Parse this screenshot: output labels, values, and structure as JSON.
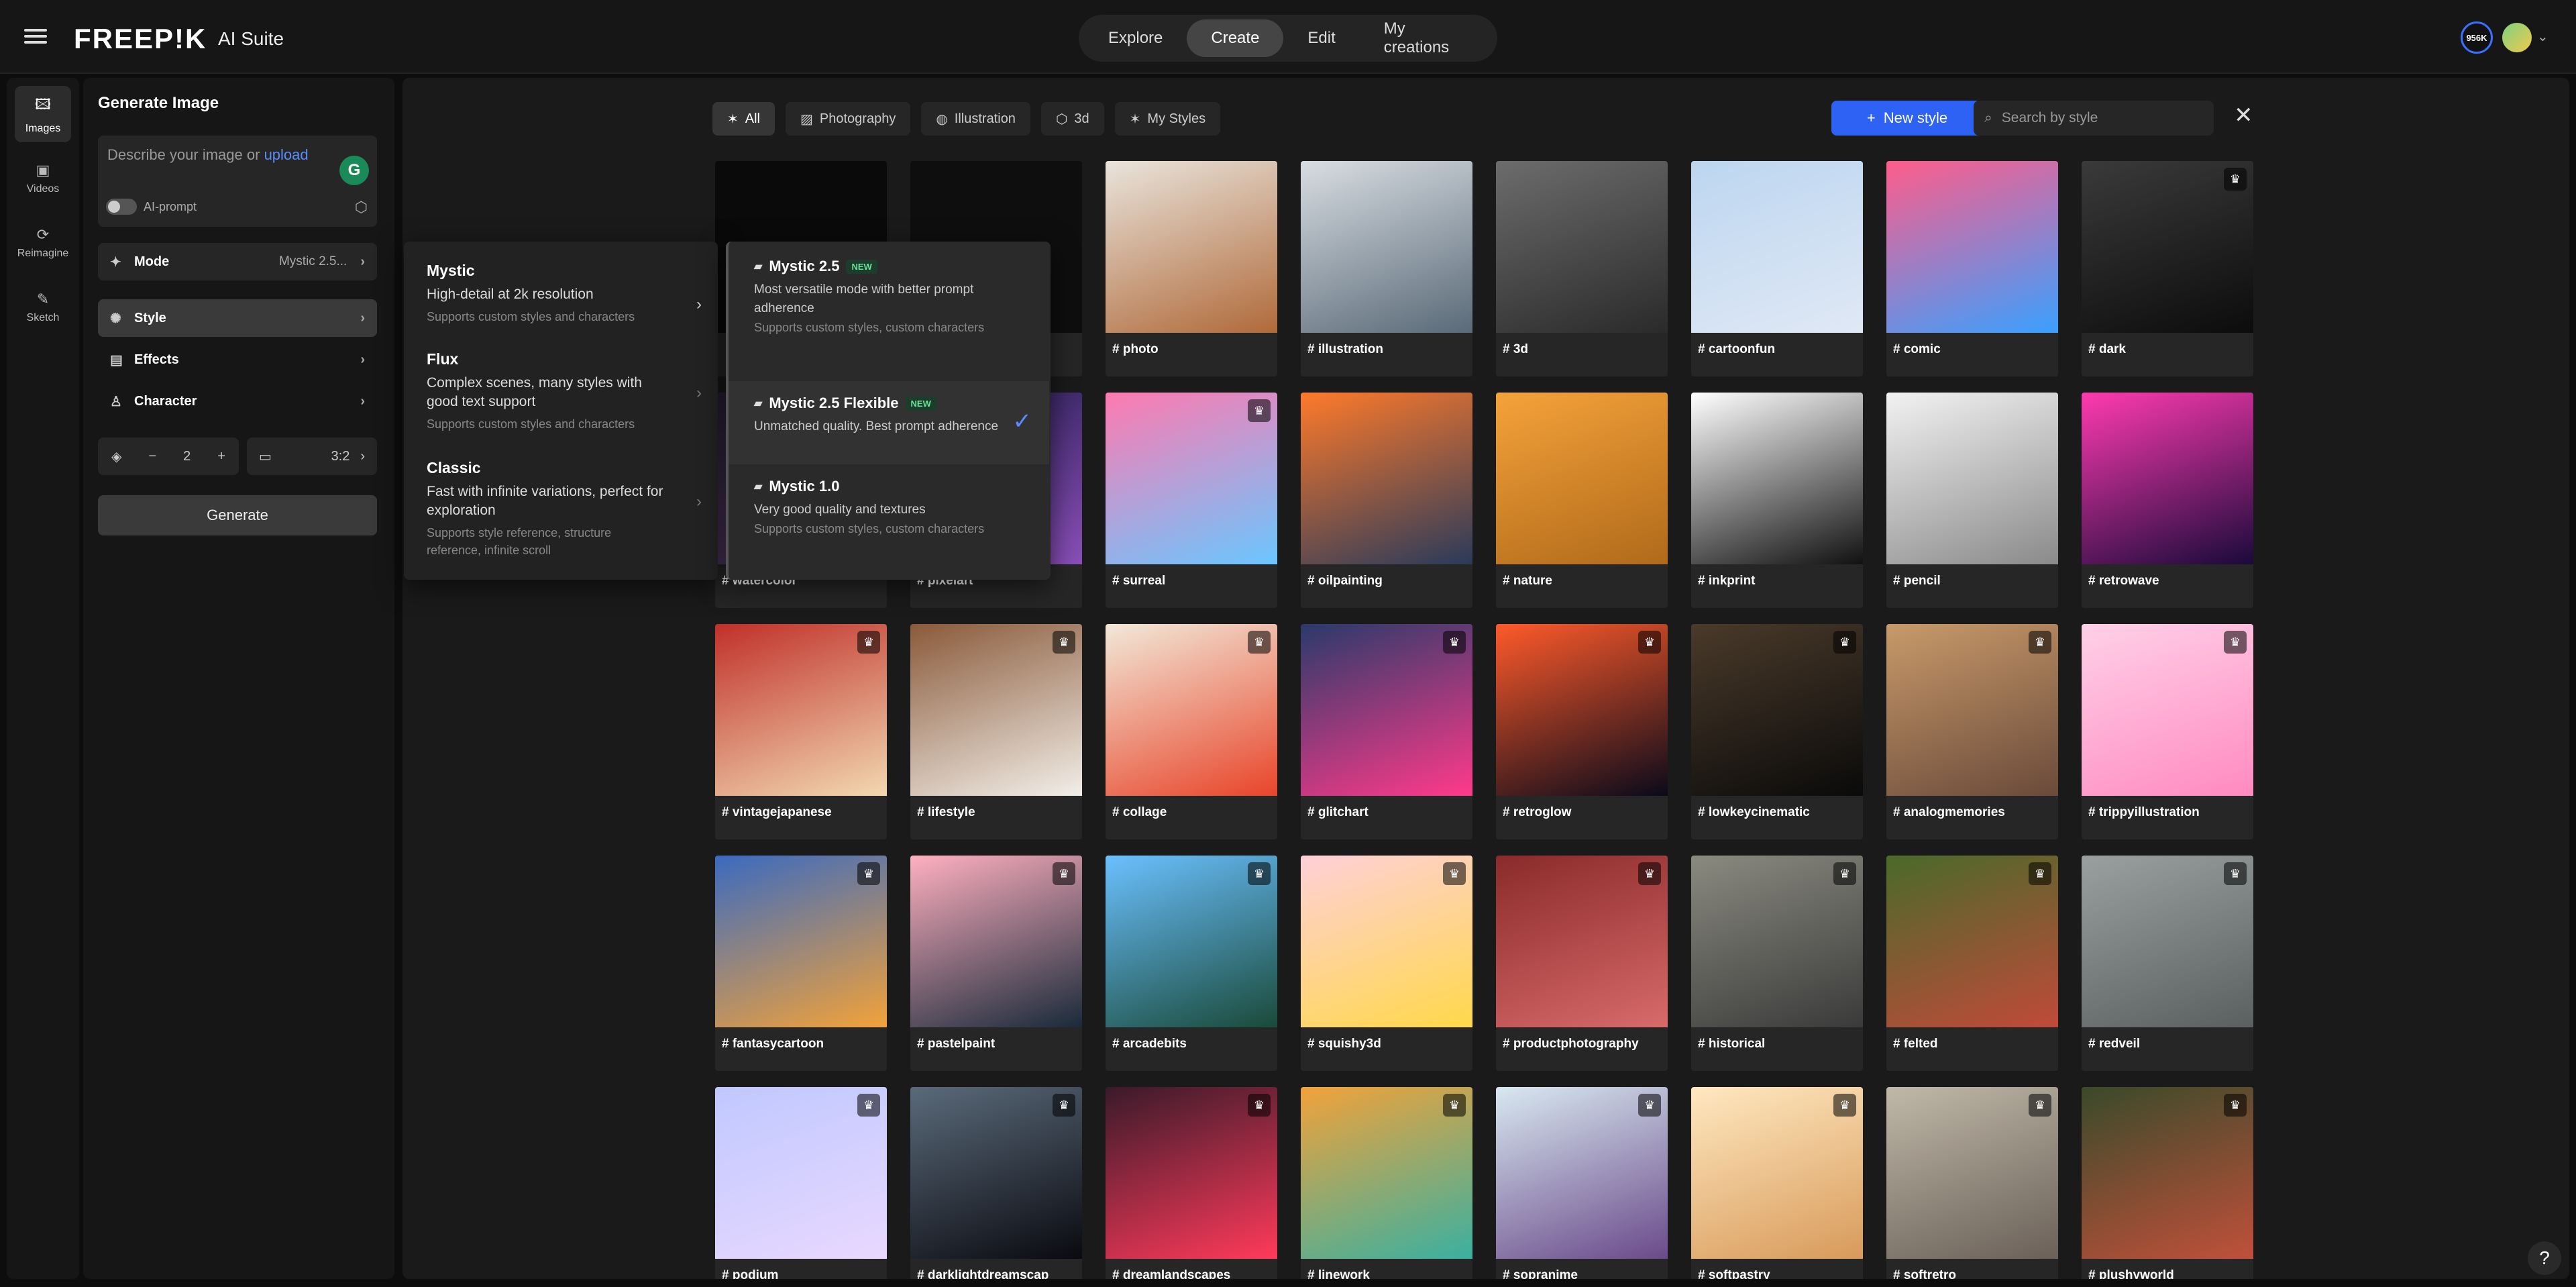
{
  "header": {
    "logo": "FREEP!K",
    "suite": "AI Suite",
    "nav": [
      "Explore",
      "Create",
      "Edit",
      "My creations"
    ],
    "active_nav": "Create",
    "credits": "956K"
  },
  "rail": [
    {
      "label": "Images",
      "icon": "images-icon"
    },
    {
      "label": "Videos",
      "icon": "videos-icon"
    },
    {
      "label": "Reimagine",
      "icon": "reimagine-icon"
    },
    {
      "label": "Sketch",
      "icon": "sketch-icon"
    }
  ],
  "panel": {
    "title": "Generate Image",
    "prompt_placeholder": "Describe your image or",
    "upload_link": "upload",
    "ai_prompt": "AI-prompt",
    "mode_label": "Mode",
    "mode_value": "Mystic 2.5...",
    "style_label": "Style",
    "effects_label": "Effects",
    "character_label": "Character",
    "count": "2",
    "ratio": "3:2",
    "generate": "Generate"
  },
  "filters": {
    "chips": [
      "All",
      "Photography",
      "Illustration",
      "3d",
      "My Styles"
    ],
    "new_style": "New style",
    "search_placeholder": "Search by style"
  },
  "styles": [
    {
      "label": "",
      "colors": [
        "#0a0a0a",
        "#0a0a0a"
      ],
      "premium": false
    },
    {
      "label": "",
      "colors": [
        "#0e0e0e",
        "#0e0e0e"
      ],
      "premium": false
    },
    {
      "label": "# photo",
      "colors": [
        "#e9e4dc",
        "#b06a3a"
      ],
      "premium": false
    },
    {
      "label": "# illustration",
      "colors": [
        "#d8dde2",
        "#5a6a78"
      ],
      "premium": false
    },
    {
      "label": "# 3d",
      "colors": [
        "#6c6c6c",
        "#2a2a2a"
      ],
      "premium": false
    },
    {
      "label": "# cartoonfun",
      "colors": [
        "#bcd6f0",
        "#e0e8f5"
      ],
      "premium": false
    },
    {
      "label": "# comic",
      "colors": [
        "#ff5c8a",
        "#3aa0ff"
      ],
      "premium": false
    },
    {
      "label": "# dark",
      "colors": [
        "#3a3a3a",
        "#0c0c0c"
      ],
      "premium": true
    },
    {
      "label": "# watercolor",
      "colors": [
        "#2a1f3a",
        "#5a3f6a"
      ],
      "premium": false
    },
    {
      "label": "# pixelart",
      "colors": [
        "#2a1f55",
        "#8a4fb8"
      ],
      "premium": false
    },
    {
      "label": "# surreal",
      "colors": [
        "#ff7ab0",
        "#6bc6ff"
      ],
      "premium": true
    },
    {
      "label": "# oilpainting",
      "colors": [
        "#ff7a2a",
        "#2a3a5a"
      ],
      "premium": false
    },
    {
      "label": "# nature",
      "colors": [
        "#f5a23a",
        "#b06a1a"
      ],
      "premium": false
    },
    {
      "label": "# inkprint",
      "colors": [
        "#ffffff",
        "#111111"
      ],
      "premium": false
    },
    {
      "label": "# pencil",
      "colors": [
        "#f2f2f2",
        "#8a8a8a"
      ],
      "premium": false
    },
    {
      "label": "# retrowave",
      "colors": [
        "#ff3ab0",
        "#1a0a3a"
      ],
      "premium": false
    },
    {
      "label": "# vintagejapanese",
      "colors": [
        "#c0302a",
        "#f2d8b0"
      ],
      "premium": true
    },
    {
      "label": "# lifestyle",
      "colors": [
        "#8a5a3a",
        "#f2eee8"
      ],
      "premium": true
    },
    {
      "label": "# collage",
      "colors": [
        "#f2e8d8",
        "#e8452a"
      ],
      "premium": true
    },
    {
      "label": "# glitchart",
      "colors": [
        "#2a3a6a",
        "#ff3a8a"
      ],
      "premium": true
    },
    {
      "label": "# retroglow",
      "colors": [
        "#ff5a2a",
        "#0a0a1a"
      ],
      "premium": true
    },
    {
      "label": "# lowkeycinematic",
      "colors": [
        "#4a3a2a",
        "#0a0a0a"
      ],
      "premium": true
    },
    {
      "label": "# analogmemories",
      "colors": [
        "#c89a6a",
        "#6a4a3a"
      ],
      "premium": true
    },
    {
      "label": "# trippyillustration",
      "colors": [
        "#ffd0e8",
        "#ff8ac0"
      ],
      "premium": true
    },
    {
      "label": "# fantasycartoon",
      "colors": [
        "#3a6ac0",
        "#f2a23a"
      ],
      "premium": true
    },
    {
      "label": "# pastelpaint",
      "colors": [
        "#ffb0c0",
        "#1a2a3a"
      ],
      "premium": true
    },
    {
      "label": "# arcadebits",
      "colors": [
        "#6ac0ff",
        "#1a4a3a"
      ],
      "premium": true
    },
    {
      "label": "# squishy3d",
      "colors": [
        "#ffd0d8",
        "#ffd84a"
      ],
      "premium": true
    },
    {
      "label": "# productphotography",
      "colors": [
        "#8a2a2a",
        "#d86a6a"
      ],
      "premium": true
    },
    {
      "label": "# historical",
      "colors": [
        "#8a8a80",
        "#3a3a3a"
      ],
      "premium": true
    },
    {
      "label": "# felted",
      "colors": [
        "#4a6a2a",
        "#c04a3a"
      ],
      "premium": true
    },
    {
      "label": "# redveil",
      "colors": [
        "#9aa0a0",
        "#5a6060"
      ],
      "premium": true
    },
    {
      "label": "# podium",
      "colors": [
        "#c0c8ff",
        "#e8d8ff"
      ],
      "premium": true
    },
    {
      "label": "# darklightdreamscap",
      "colors": [
        "#5a6a7a",
        "#0a0a10"
      ],
      "premium": true
    },
    {
      "label": "# dreamlandscapes",
      "colors": [
        "#3a1a2a",
        "#ff3a5a"
      ],
      "premium": true
    },
    {
      "label": "# linework",
      "colors": [
        "#f2a23a",
        "#3ab0a0"
      ],
      "premium": true
    },
    {
      "label": "# sopranime",
      "colors": [
        "#d8e8f0",
        "#6a4a8a"
      ],
      "premium": true
    },
    {
      "label": "# softpastry",
      "colors": [
        "#ffe8c0",
        "#d89a5a"
      ],
      "premium": true
    },
    {
      "label": "# softretro",
      "colors": [
        "#c0b8a8",
        "#6a6058"
      ],
      "premium": true
    },
    {
      "label": "# plushyworld",
      "colors": [
        "#3a4a2a",
        "#c0503a"
      ],
      "premium": true
    }
  ],
  "mode_menu": [
    {
      "title": "Mystic",
      "desc": "High-detail at 2k resolution",
      "sub": "Supports custom styles and characters"
    },
    {
      "title": "Flux",
      "desc": "Complex scenes, many styles with good text support",
      "sub": "Supports custom styles and characters"
    },
    {
      "title": "Classic",
      "desc": "Fast with infinite variations, perfect for exploration",
      "sub": "Supports style reference, structure reference, infinite scroll"
    }
  ],
  "mystic_submenu": [
    {
      "title": "Mystic 2.5",
      "badge": "NEW",
      "desc": "Most versatile mode with better prompt adherence",
      "sub": "Supports custom styles, custom characters",
      "selected": false
    },
    {
      "title": "Mystic 2.5 Flexible",
      "badge": "NEW",
      "desc": "Unmatched quality. Best prompt adherence",
      "sub": "",
      "selected": true
    },
    {
      "title": "Mystic 1.0",
      "badge": "",
      "desc": "Very good quality and textures",
      "sub": "Supports custom styles, custom characters",
      "selected": false
    }
  ],
  "help": "?"
}
